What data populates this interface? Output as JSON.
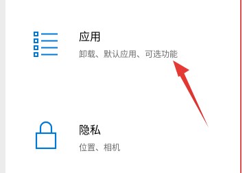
{
  "settings": {
    "items": [
      {
        "title": "应用",
        "subtitle": "卸载、默认应用、可选功能",
        "icon": "apps-list-icon"
      },
      {
        "title": "隐私",
        "subtitle": "位置、相机",
        "icon": "lock-icon"
      }
    ]
  },
  "colors": {
    "accent": "#0078d7",
    "annotation_arrow": "#e53935",
    "subtitle_text": "#6b6b6b"
  }
}
